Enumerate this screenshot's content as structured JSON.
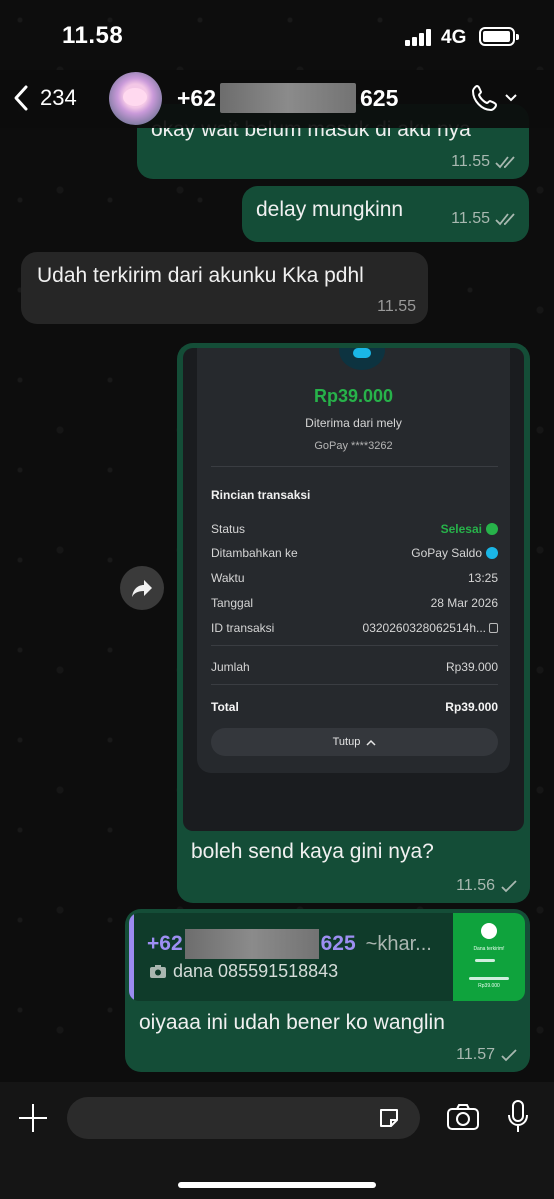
{
  "status_bar": {
    "time": "11.58",
    "network": "4G"
  },
  "header": {
    "back_count": "234",
    "contact_prefix": "+62",
    "contact_suffix": "625"
  },
  "messages": [
    {
      "text": "okay wait belum masuk di aku nya",
      "time": "11.55"
    },
    {
      "text": "delay mungkinn",
      "time": "11.55"
    },
    {
      "text": "Udah terkirim dari akunku Kka pdhl",
      "time": "11.55"
    },
    {
      "text": "boleh send kaya gini nya?",
      "time": "11.56"
    },
    {
      "text": "oiyaaa ini udah bener ko wanglin",
      "time": "11.57"
    }
  ],
  "receipt": {
    "amount": "Rp39.000",
    "received_from": "Diterima dari mely",
    "account": "GoPay ****3262",
    "heading": "Rincian transaksi",
    "rows": [
      {
        "label": "Status",
        "value": "Selesai"
      },
      {
        "label": "Ditambahkan ke",
        "value": "GoPay Saldo"
      },
      {
        "label": "Waktu",
        "value": "13:25"
      },
      {
        "label": "Tanggal",
        "value": "28 Mar 2026"
      },
      {
        "label": "ID transaksi",
        "value": "0320260328062514h..."
      },
      {
        "label": "Jumlah",
        "value": "Rp39.000"
      },
      {
        "label": "Total",
        "value": "Rp39.000"
      }
    ],
    "close_label": "Tutup",
    "status_color": "#27b24a"
  },
  "quote": {
    "name_prefix": "+62",
    "name_suffix": "625",
    "sender_alias": "~khar...",
    "text": "dana 085591518843",
    "thumb_title": "Dana terkirim!",
    "thumb_amount": "Rp39.000"
  },
  "colors": {
    "outgoing_bubble": "#144d37",
    "incoming_bubble": "#262626",
    "quote_accent": "#9b8bf0"
  }
}
